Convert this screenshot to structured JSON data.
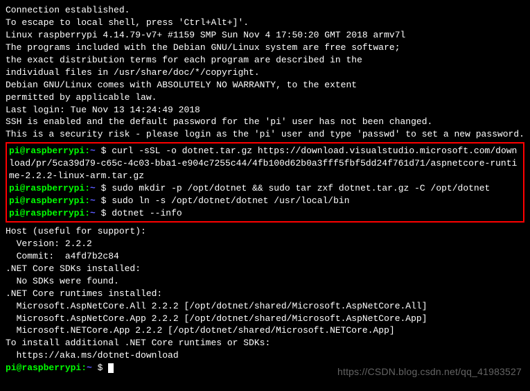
{
  "motd": {
    "l1": "Connection established.",
    "l2": "To escape to local shell, press 'Ctrl+Alt+]'.",
    "l3": "",
    "l4": "Linux raspberrypi 4.14.79-v7+ #1159 SMP Sun Nov 4 17:50:20 GMT 2018 armv7l",
    "l5": "",
    "l6": "The programs included with the Debian GNU/Linux system are free software;",
    "l7": "the exact distribution terms for each program are described in the",
    "l8": "individual files in /usr/share/doc/*/copyright.",
    "l9": "",
    "l10": "Debian GNU/Linux comes with ABSOLUTELY NO WARRANTY, to the extent",
    "l11": "permitted by applicable law.",
    "l12": "Last login: Tue Nov 13 14:24:49 2018",
    "l13": "",
    "l14": "SSH is enabled and the default password for the 'pi' user has not been changed.",
    "l15": "This is a security risk - please login as the 'pi' user and type 'passwd' to set a new password.",
    "l16": ""
  },
  "prompt": {
    "user_host": "pi@raspberrypi",
    "colon": ":",
    "path": "~",
    "marker": " $ "
  },
  "commands": {
    "cmd1": "curl -sSL -o dotnet.tar.gz https://download.visualstudio.microsoft.com/download/pr/5ca39d79-c65c-4c03-bba1-e904c7255c44/4fb100d62b0a3fff5fbf5dd24f761d71/aspnetcore-runtime-2.2.2-linux-arm.tar.gz",
    "cmd2": "sudo mkdir -p /opt/dotnet && sudo tar zxf dotnet.tar.gz -C /opt/dotnet",
    "cmd3": "sudo ln -s /opt/dotnet/dotnet /usr/local/bin",
    "cmd4": "dotnet --info"
  },
  "output": {
    "o1": "",
    "o2": "Host (useful for support):",
    "o3": "  Version: 2.2.2",
    "o4": "  Commit:  a4fd7b2c84",
    "o5": "",
    "o6": ".NET Core SDKs installed:",
    "o7": "  No SDKs were found.",
    "o8": "",
    "o9": ".NET Core runtimes installed:",
    "o10": "  Microsoft.AspNetCore.All 2.2.2 [/opt/dotnet/shared/Microsoft.AspNetCore.All]",
    "o11": "  Microsoft.AspNetCore.App 2.2.2 [/opt/dotnet/shared/Microsoft.AspNetCore.App]",
    "o12": "  Microsoft.NETCore.App 2.2.2 [/opt/dotnet/shared/Microsoft.NETCore.App]",
    "o13": "",
    "o14": "To install additional .NET Core runtimes or SDKs:",
    "o15": "  https://aka.ms/dotnet-download"
  },
  "watermark": "https://CSDN.blog.csdn.net/qq_41983527"
}
